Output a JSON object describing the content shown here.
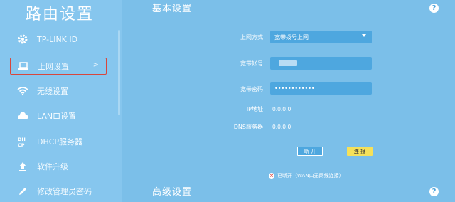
{
  "app_title": "路由设置",
  "sidebar": {
    "items": [
      {
        "label": "TP-LINK ID",
        "icon": "gear-icon"
      },
      {
        "label": "上网设置",
        "icon": "laptop-icon",
        "chevron": ">"
      },
      {
        "label": "无线设置",
        "icon": "wifi-icon"
      },
      {
        "label": "LAN口设置",
        "icon": "cloud-icon"
      },
      {
        "label": "DHCP服务器",
        "icon": "dhcp-icon"
      },
      {
        "label": "软件升级",
        "icon": "upload-icon"
      },
      {
        "label": "修改管理员密码",
        "icon": "pencil-icon"
      }
    ]
  },
  "main": {
    "basic_title": "基本设置",
    "advanced_title": "高级设置",
    "help": "?",
    "form": {
      "wan_mode_label": "上网方式",
      "wan_mode_value": "宽带拨号上网",
      "account_label": "宽带帐号",
      "password_label": "宽带密码",
      "password_value": "••••••••••••",
      "ip_label": "IP地址",
      "ip_value": "0.0.0.0",
      "dns_label": "DNS服务器",
      "dns_value": "0.0.0.0"
    },
    "disconnect_label": "断 开",
    "connect_label": "连 接",
    "status_text": "已断开（WAN口无网线连接）"
  },
  "colors": {
    "background": "#7bbfe9",
    "sidebar": "#86c6ee",
    "input": "#4ea7df",
    "connect_button": "#f5e15a",
    "active_border": "#d8463c"
  }
}
